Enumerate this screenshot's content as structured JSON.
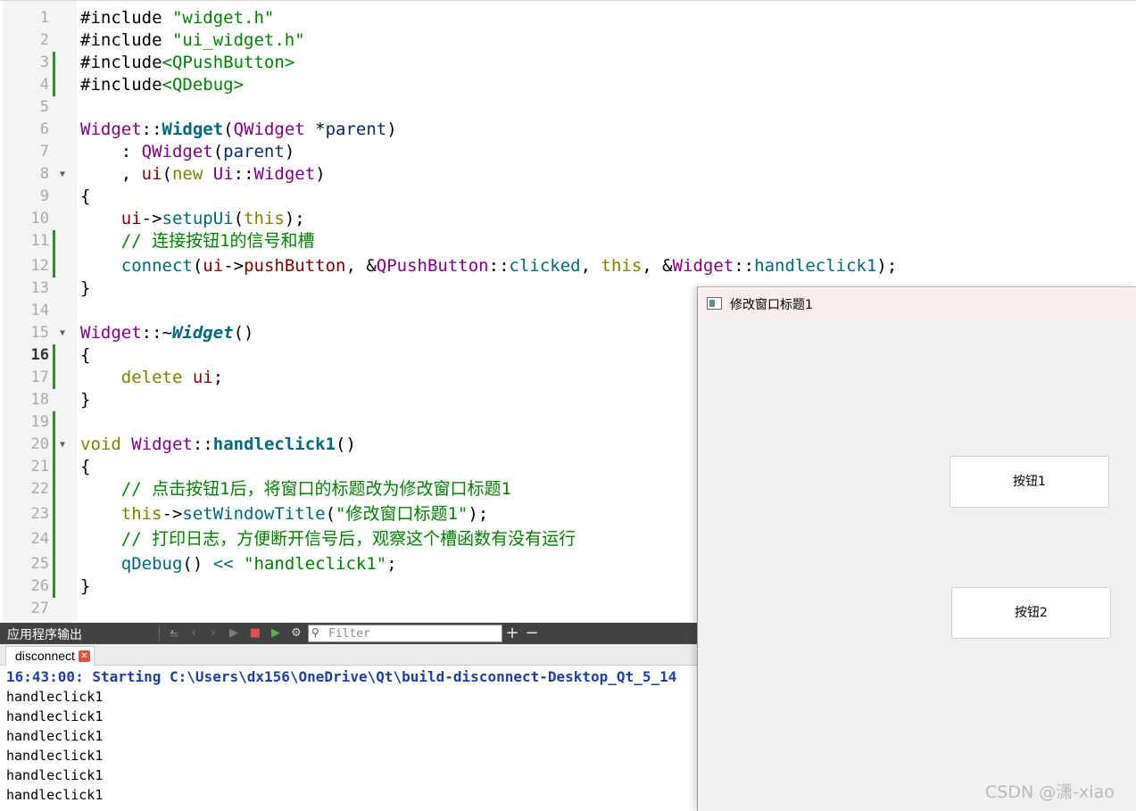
{
  "editor": {
    "current_line": 16,
    "line_numbers": [
      "1",
      "2",
      "3",
      "4",
      "5",
      "6",
      "7",
      "8",
      "9",
      "10",
      "11",
      "12",
      "13",
      "14",
      "15",
      "16",
      "17",
      "18",
      "19",
      "20",
      "21",
      "22",
      "23",
      "24",
      "25",
      "26",
      "27"
    ],
    "lines": [
      [
        [
          "t-op",
          "#include "
        ],
        [
          "t-str",
          "\"widget.h\""
        ]
      ],
      [
        [
          "t-op",
          "#include "
        ],
        [
          "t-str",
          "\"ui_widget.h\""
        ]
      ],
      [
        [
          "t-op",
          "#include"
        ],
        [
          "t-str",
          "<QPushButton>"
        ]
      ],
      [
        [
          "t-op",
          "#include"
        ],
        [
          "t-str",
          "<QDebug>"
        ]
      ],
      [],
      [
        [
          "t-type",
          "Widget"
        ],
        [
          "t-op",
          "::"
        ],
        [
          "t-fnb",
          "Widget"
        ],
        [
          "t-op",
          "("
        ],
        [
          "t-type",
          "QWidget"
        ],
        [
          "t-op",
          " *"
        ],
        [
          "t-param",
          "parent"
        ],
        [
          "t-op",
          ")"
        ]
      ],
      [
        [
          "t-op",
          "    : "
        ],
        [
          "t-type",
          "QWidget"
        ],
        [
          "t-op",
          "("
        ],
        [
          "t-param",
          "parent"
        ],
        [
          "t-op",
          ")"
        ]
      ],
      [
        [
          "t-op",
          "    , "
        ],
        [
          "t-mem",
          "ui"
        ],
        [
          "t-op",
          "("
        ],
        [
          "t-kw",
          "new"
        ],
        [
          "t-op",
          " "
        ],
        [
          "t-type",
          "Ui"
        ],
        [
          "t-op",
          "::"
        ],
        [
          "t-type",
          "Widget"
        ],
        [
          "t-op",
          ")"
        ]
      ],
      [
        [
          "t-op",
          "{"
        ]
      ],
      [
        [
          "t-op",
          "    "
        ],
        [
          "t-mem",
          "ui"
        ],
        [
          "t-op",
          "->"
        ],
        [
          "t-fn",
          "setupUi"
        ],
        [
          "t-op",
          "("
        ],
        [
          "t-kw",
          "this"
        ],
        [
          "t-op",
          ");"
        ]
      ],
      [
        [
          "t-op",
          "    "
        ],
        [
          "t-cmt",
          "// 连接按钮1的信号和槽"
        ]
      ],
      [
        [
          "t-op",
          "    "
        ],
        [
          "t-fn",
          "connect"
        ],
        [
          "t-op",
          "("
        ],
        [
          "t-mem",
          "ui"
        ],
        [
          "t-op",
          "->"
        ],
        [
          "t-mem",
          "pushButton"
        ],
        [
          "t-op",
          ", &"
        ],
        [
          "t-type",
          "QPushButton"
        ],
        [
          "t-op",
          "::"
        ],
        [
          "t-fn",
          "clicked"
        ],
        [
          "t-op",
          ", "
        ],
        [
          "t-kw",
          "this"
        ],
        [
          "t-op",
          ", &"
        ],
        [
          "t-type",
          "Widget"
        ],
        [
          "t-op",
          "::"
        ],
        [
          "t-fn",
          "handleclick1"
        ],
        [
          "t-op",
          ");"
        ]
      ],
      [
        [
          "t-op",
          "}"
        ]
      ],
      [],
      [
        [
          "t-type",
          "Widget"
        ],
        [
          "t-op",
          "::~"
        ],
        [
          "t-fnbi",
          "Widget"
        ],
        [
          "t-op",
          "()"
        ]
      ],
      [
        [
          "t-op",
          "{"
        ]
      ],
      [
        [
          "t-op",
          "    "
        ],
        [
          "t-kw",
          "delete"
        ],
        [
          "t-op",
          " "
        ],
        [
          "t-mem",
          "ui"
        ],
        [
          "t-op",
          ";"
        ]
      ],
      [
        [
          "t-op",
          "}"
        ]
      ],
      [],
      [
        [
          "t-kw",
          "void"
        ],
        [
          "t-op",
          " "
        ],
        [
          "t-type",
          "Widget"
        ],
        [
          "t-op",
          "::"
        ],
        [
          "t-fnb",
          "handleclick1"
        ],
        [
          "t-op",
          "()"
        ]
      ],
      [
        [
          "t-op",
          "{"
        ]
      ],
      [
        [
          "t-op",
          "    "
        ],
        [
          "t-cmt",
          "// 点击按钮1后，将窗口的标题改为修改窗口标题1"
        ]
      ],
      [
        [
          "t-op",
          "    "
        ],
        [
          "t-kw",
          "this"
        ],
        [
          "t-op",
          "->"
        ],
        [
          "t-fn",
          "setWindowTitle"
        ],
        [
          "t-op",
          "("
        ],
        [
          "t-str",
          "\"修改窗口标题1\""
        ],
        [
          "t-op",
          ");"
        ]
      ],
      [
        [
          "t-op",
          "    "
        ],
        [
          "t-cmt",
          "// 打印日志，方便断开信号后，观察这个槽函数有没有运行"
        ]
      ],
      [
        [
          "t-op",
          "    "
        ],
        [
          "t-fn",
          "qDebug"
        ],
        [
          "t-op",
          "() "
        ],
        [
          "t-fn",
          "<<"
        ],
        [
          "t-op",
          " "
        ],
        [
          "t-str",
          "\"handleclick1\""
        ],
        [
          "t-op",
          ";"
        ]
      ],
      [
        [
          "t-op",
          "}"
        ]
      ],
      []
    ]
  },
  "output_pane": {
    "title": "应用程序输出",
    "toolbar_icons": [
      "attach-debugger-icon",
      "previous-icon",
      "next-icon",
      "run-icon",
      "stop-icon",
      "rerun-icon",
      "settings-icon"
    ],
    "filter_placeholder": "Filter",
    "zoom_in_label": "+",
    "zoom_out_label": "−",
    "tab_label": "disconnect",
    "start_line": "16:43:00: Starting C:\\Users\\dx156\\OneDrive\\Qt\\build-disconnect-Desktop_Qt_5_14",
    "log_lines": [
      "handleclick1",
      "handleclick1",
      "handleclick1",
      "handleclick1",
      "handleclick1",
      "handleclick1"
    ]
  },
  "app_window": {
    "title": "修改窗口标题1",
    "button1_label": "按钮1",
    "button2_label": "按钮2"
  },
  "watermark": "CSDN @潇-xiao",
  "colors": {
    "keyword": "#808000",
    "string": "#008000",
    "type": "#800080",
    "function": "#00677c",
    "comment": "#008000",
    "change_bar": "#2e8b2e",
    "stop_red": "#e05050",
    "run_green": "#5fae52"
  }
}
